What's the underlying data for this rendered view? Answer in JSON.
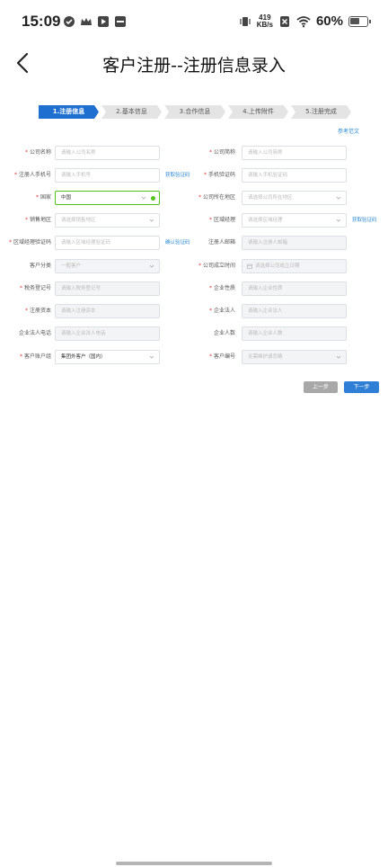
{
  "status_bar": {
    "time": "15:09",
    "speed_value": "419",
    "speed_unit": "KB/s",
    "battery": "60%",
    "battery_level": 0.6
  },
  "header": {
    "title": "客户注册--注册信息录入"
  },
  "steps": [
    {
      "label": "1.注册信息",
      "active": true
    },
    {
      "label": "2.基本信息",
      "active": false
    },
    {
      "label": "3.合作信息",
      "active": false
    },
    {
      "label": "4.上传附件",
      "active": false
    },
    {
      "label": "5.注册完成",
      "active": false
    }
  ],
  "reference_link": "参考范文",
  "form": {
    "company_name": {
      "label": "公司名称",
      "placeholder": "请输入公司名称"
    },
    "company_short": {
      "label": "公司简称",
      "placeholder": "请输入公司简称"
    },
    "reg_phone": {
      "label": "注册人手机号",
      "placeholder": "请输入手机号",
      "action": "获取验证码"
    },
    "phone_code": {
      "label": "手机验证码",
      "placeholder": "请输入手机验证码"
    },
    "country": {
      "label": "国家",
      "value": "中国"
    },
    "company_region": {
      "label": "公司所在地区",
      "placeholder": "请选择公司所在地区"
    },
    "sales_region": {
      "label": "销售地区",
      "placeholder": "请选择销售地区"
    },
    "area_manager": {
      "label": "区域经理",
      "placeholder": "请选择区域经理",
      "action": "获取验证码"
    },
    "area_manager_code": {
      "label": "区域经理验证码",
      "placeholder": "请输入区域经理验证码",
      "action": "确认验证码"
    },
    "reg_email": {
      "label": "注册人邮箱",
      "placeholder": "请输入注册人邮箱"
    },
    "customer_category": {
      "label": "客户分类",
      "placeholder": "一般客户"
    },
    "established_date": {
      "label": "公司成立时间",
      "placeholder": "请选择公司成立日期"
    },
    "tax_id": {
      "label": "税务登记号",
      "placeholder": "请输入税务登记号"
    },
    "enterprise_nature": {
      "label": "企业性质",
      "placeholder": "请输入企业性质"
    },
    "registered_capital": {
      "label": "注册资本",
      "placeholder": "请输入注册资本"
    },
    "legal_person": {
      "label": "企业法人",
      "placeholder": "请输入企业法人"
    },
    "legal_phone": {
      "label": "企业法人电话",
      "placeholder": "请输入企业法人电话"
    },
    "employee_count": {
      "label": "企业人数",
      "placeholder": "请输入企业人数"
    },
    "account_group": {
      "label": "客户账户组",
      "value": "集团外客户（国内）"
    },
    "customer_code": {
      "label": "客户编号",
      "placeholder": "无需维护请忽略"
    }
  },
  "buttons": {
    "prev": "上一步",
    "next": "下一步"
  },
  "colors": {
    "primary": "#1f6fd1",
    "link": "#2b8ad4",
    "required": "#e23c3c",
    "valid": "#52c41a"
  }
}
